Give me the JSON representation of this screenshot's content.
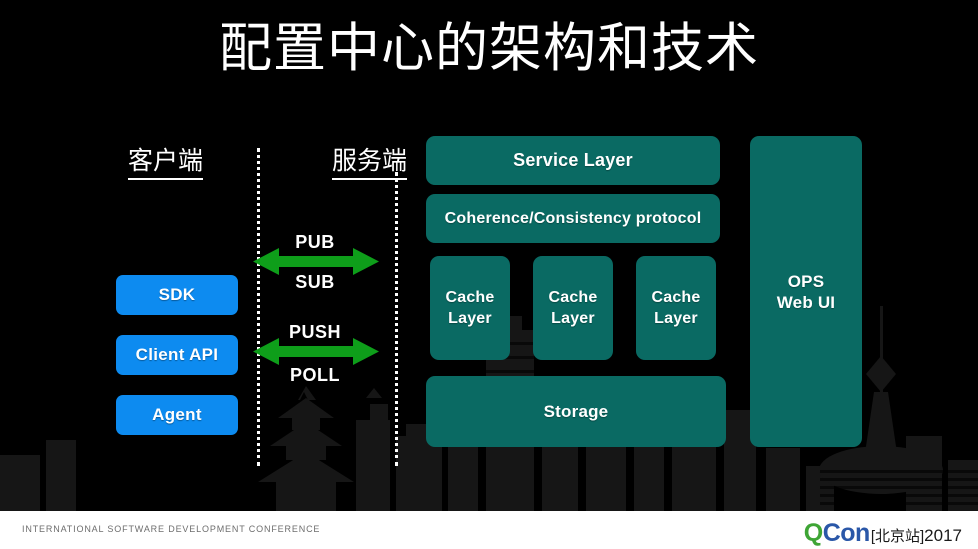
{
  "slide": {
    "title": "配置中心的架构和技术",
    "background_color": "#000000",
    "title_color": "#ffffff"
  },
  "sections": {
    "client_label": "客户端",
    "server_label": "服务端"
  },
  "client": {
    "boxes": [
      {
        "label": "SDK"
      },
      {
        "label": "Client API"
      },
      {
        "label": "Agent"
      }
    ],
    "box_color": "#0d8bf0"
  },
  "arrows": {
    "color": "#0e9e1a",
    "groups": [
      {
        "top_label": "PUB",
        "bottom_label": "SUB"
      },
      {
        "top_label": "PUSH",
        "bottom_label": "POLL"
      }
    ]
  },
  "server": {
    "box_color": "#0a6a63",
    "service_layer": "Service Layer",
    "coherence": "Coherence/Consistency protocol",
    "cache_layers": [
      {
        "label": "Cache\nLayer"
      },
      {
        "label": "Cache\nLayer"
      },
      {
        "label": "Cache\nLayer"
      }
    ],
    "cache_label_line1": "Cache",
    "cache_label_line2": "Layer",
    "storage": "Storage",
    "ops_line1": "OPS",
    "ops_line2": "Web UI"
  },
  "footer": {
    "tagline": "INTERNATIONAL SOFTWARE DEVELOPMENT CONFERENCE",
    "logo_q": "Q",
    "logo_con": "Con",
    "logo_city": "[北京站]",
    "logo_year": "2017",
    "logo_q_color": "#3ea535",
    "logo_con_color": "#2a57a8",
    "background_color": "#ffffff"
  }
}
